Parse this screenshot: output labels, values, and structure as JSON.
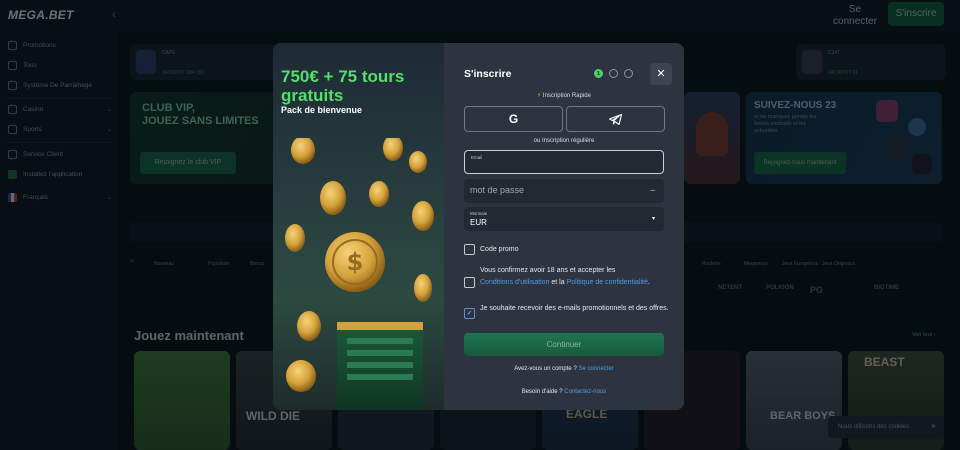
{
  "app": {
    "logo": "MEGA.BET",
    "collapse_glyph": "‹"
  },
  "header": {
    "login_label": "Se connecter",
    "signup_label": "S'inscrire"
  },
  "sidebar": {
    "items": [
      {
        "label": "Promotions",
        "icon": "gift-icon",
        "chevron": ""
      },
      {
        "label": "Tous",
        "icon": "box-icon",
        "chevron": ""
      },
      {
        "label": "Système De Parrainage",
        "icon": "users-icon",
        "chevron": ""
      },
      {
        "label": "Casino",
        "icon": "casino-icon",
        "chevron": "⌄"
      },
      {
        "label": "Sports",
        "icon": "ball-icon",
        "chevron": "⌄"
      },
      {
        "label": "Service Client",
        "icon": "headset-icon",
        "chevron": ""
      },
      {
        "label": "Installez l'application",
        "icon": "phone-icon",
        "chevron": ""
      },
      {
        "label": "Français",
        "icon": "flag-icon",
        "chevron": "⌄"
      }
    ]
  },
  "background": {
    "jackpots": [
      {
        "label": "CAPE",
        "value": "JACKPOT 384 097"
      },
      {
        "label": "C347",
        "value": "JACKPOT 91"
      }
    ],
    "vip_banner": {
      "title_line1": "CLUB VIP,",
      "title_line2": "JOUEZ SANS LIMITES",
      "button": "Rejoignez le club VIP"
    },
    "social_banner": {
      "title": "SUIVEZ-NOUS 23",
      "text_line1": "et ne manquez jamais les",
      "text_line2": "bonus exclusifs et les",
      "text_line3": "actualités",
      "button": "Rejoignez-nous maintenant"
    },
    "categories": [
      "Nouveau",
      "Populaire",
      "Bonus",
      "Roulette",
      "Megaways",
      "Jeux Européens",
      "Jeux Originaux"
    ],
    "providers": [
      "NETENT",
      "POLIGON",
      "PG",
      "BIGTIME"
    ],
    "section_title": "Jouez maintenant",
    "view_all": "Voir tout ›",
    "games": [
      "WILD DIE",
      "EAGLE",
      "BEAST",
      "BEAR BOYS"
    ],
    "cookie_text": "Nous utilisons des cookies",
    "cookie_close": "✕"
  },
  "modal": {
    "promo_title": "750€ + 75 tours gratuits",
    "promo_subtitle": "Pack de bienvenue",
    "title": "S'inscrire",
    "steps": {
      "active": "1",
      "total": 3
    },
    "close_glyph": "✕",
    "quick_signup": "Inscription Rapide",
    "quick_icon": "⚡",
    "google_icon": "G",
    "or_regular": "ou Inscription régulière",
    "email_label": "Email",
    "password_placeholder": "mot de passe",
    "password_eye": "•••",
    "currency_label": "Monnaie",
    "currency_value": "EUR",
    "currency_caret": "▾",
    "promo_code_label": "Code promo",
    "terms_text_1": "Vous confirmez avoir 18 ans et accepter les",
    "terms_link_1": "Conditions d'utilisation",
    "terms_text_2": " et la ",
    "terms_link_2": "Politique de confidentialité",
    "terms_text_3": ".",
    "newsletter_text": "Je souhaite recevoir des e-mails promotionnels et des offres.",
    "newsletter_checked": true,
    "checkmark": "✓",
    "continue_label": "Continuer",
    "have_account": "Avez-vous un compte ? ",
    "login_link": "Se connecter",
    "need_help": "Besoin d'aide ? ",
    "contact_link": "Contactez-nous"
  },
  "colors": {
    "accent_green": "#53e06a",
    "link_blue": "#4f9be8",
    "button_green": "#1f7451"
  }
}
